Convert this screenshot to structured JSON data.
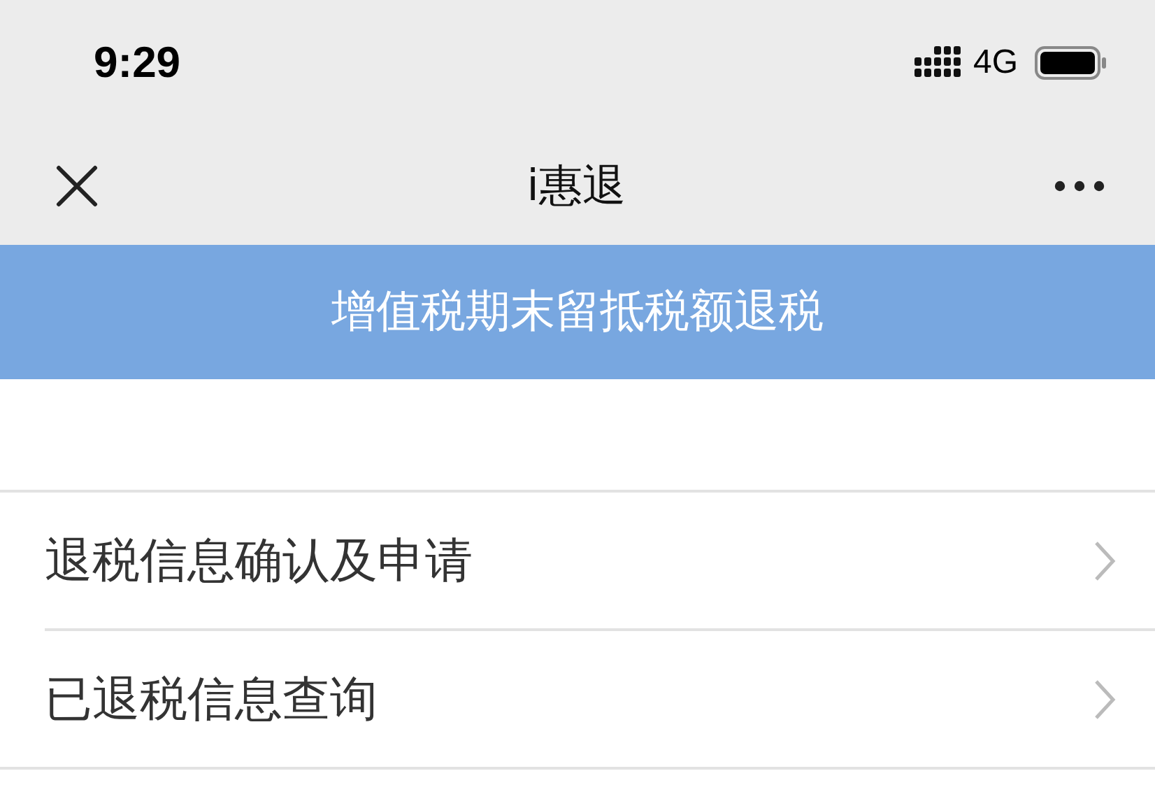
{
  "status_bar": {
    "time": "9:29",
    "network": "4G"
  },
  "nav_bar": {
    "title": "i惠退"
  },
  "banner": {
    "title": "增值税期末留抵税额退税"
  },
  "menu_items": [
    {
      "label": "退税信息确认及申请"
    },
    {
      "label": "已退税信息查询"
    }
  ]
}
